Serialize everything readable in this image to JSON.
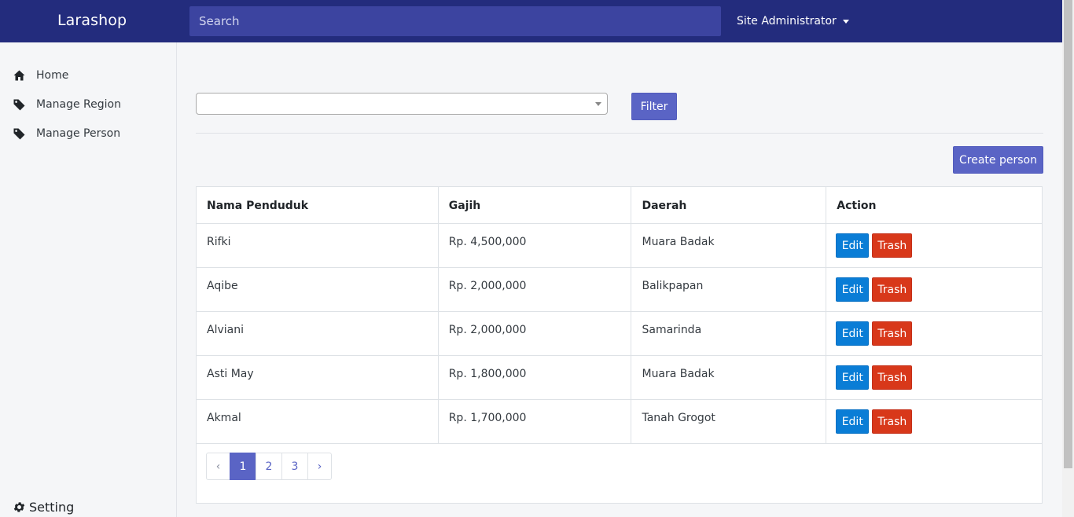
{
  "app": {
    "brand": "Larashop"
  },
  "header": {
    "search_placeholder": "Search",
    "user": "Site Administrator"
  },
  "sidebar": {
    "items": [
      {
        "label": "Home",
        "icon": "home-icon"
      },
      {
        "label": "Manage Region",
        "icon": "tag-icon"
      },
      {
        "label": "Manage Person",
        "icon": "tag-icon"
      }
    ],
    "setting_label": "Setting"
  },
  "filter": {
    "select_value": "",
    "button_label": "Filter"
  },
  "create_label": "Create person",
  "table": {
    "headers": [
      "Nama Penduduk",
      "Gajih",
      "Daerah",
      "Action"
    ],
    "rows": [
      {
        "name": "Rifki",
        "salary": "Rp. 4,500,000",
        "region": "Muara Badak"
      },
      {
        "name": "Aqibe",
        "salary": "Rp. 2,000,000",
        "region": "Balikpapan"
      },
      {
        "name": "Alviani",
        "salary": "Rp. 2,000,000",
        "region": "Samarinda"
      },
      {
        "name": "Asti May",
        "salary": "Rp. 1,800,000",
        "region": "Muara Badak"
      },
      {
        "name": "Akmal",
        "salary": "Rp. 1,700,000",
        "region": "Tanah Grogot"
      }
    ],
    "edit_label": "Edit",
    "trash_label": "Trash"
  },
  "pagination": {
    "prev": "‹",
    "pages": [
      "1",
      "2",
      "3"
    ],
    "active": "1",
    "next": "›"
  },
  "colors": {
    "navbar": "#232c7d",
    "primary": "#5a64c5",
    "edit": "#0a7dd6",
    "trash": "#d8381a"
  }
}
